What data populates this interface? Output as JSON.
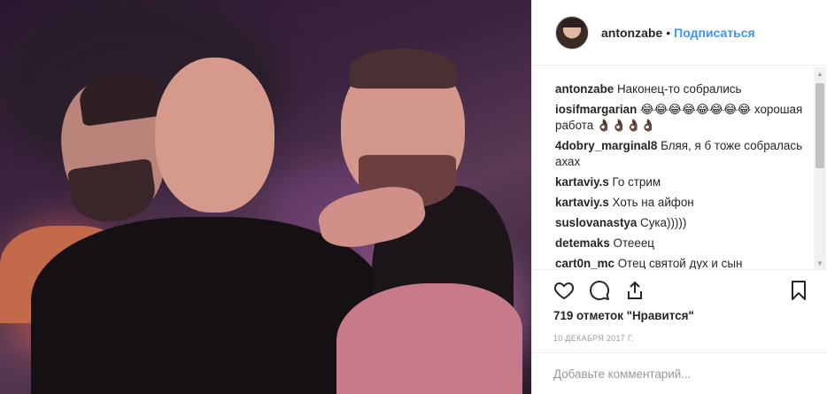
{
  "post": {
    "author": "antonzabe",
    "separator": "•",
    "follow_label": "Подписаться",
    "likes_text": "719 отметок \"Нравится\"",
    "date": "10 ДЕКАБРЯ 2017 Г.",
    "add_comment_placeholder": "Добавьте комментарий..."
  },
  "comments": [
    {
      "user": "antonzabe",
      "text": "Наконец-то собрались"
    },
    {
      "user": "iosifmargarian",
      "text": "😂😂😂😂😂😂😂😂 хорошая работа 👌🏿👌🏿👌🏿👌🏿"
    },
    {
      "user": "4dobry_marginal8",
      "text": "Бляя, я б тоже собралась ахах"
    },
    {
      "user": "kartaviy.s",
      "text": "Го стрим"
    },
    {
      "user": "kartaviy.s",
      "text": "Хоть на айфон"
    },
    {
      "user": "suslovanastya",
      "text": "Сука)))))"
    },
    {
      "user": "detemaks",
      "text": "Отееец"
    },
    {
      "user": "cart0n_mc",
      "text": "Отец святой дух и сын"
    }
  ],
  "icons": {
    "like": "heart-icon",
    "comment": "speech-bubble-icon",
    "share": "share-icon",
    "save": "bookmark-icon"
  },
  "colors": {
    "link": "#3897f0",
    "text": "#262626",
    "muted": "#999999",
    "border": "#efefef"
  }
}
